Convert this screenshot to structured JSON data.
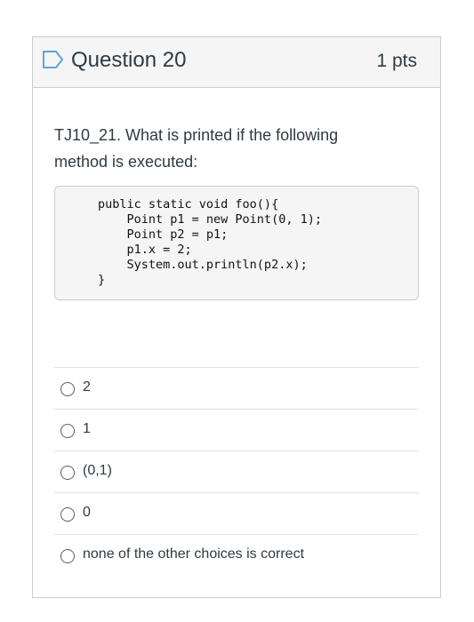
{
  "question": {
    "title": "Question 20",
    "points": "1 pts",
    "text": "TJ10_21. What is printed if the following method is executed:",
    "code": "public static void foo(){\n    Point p1 = new Point(0, 1);\n    Point p2 = p1;\n    p1.x = 2;\n    System.out.println(p2.x);\n}",
    "flag_icon": "bookmark-flag-icon"
  },
  "answers": [
    {
      "label": "2"
    },
    {
      "label": "1"
    },
    {
      "label": "(0,1)"
    },
    {
      "label": "0"
    },
    {
      "label": "none of the other choices is correct"
    }
  ],
  "colors": {
    "header_bg": "#f5f5f5",
    "border": "#c7cdd1",
    "text": "#2d3b45",
    "flag_blue": "#5ba4e0"
  }
}
